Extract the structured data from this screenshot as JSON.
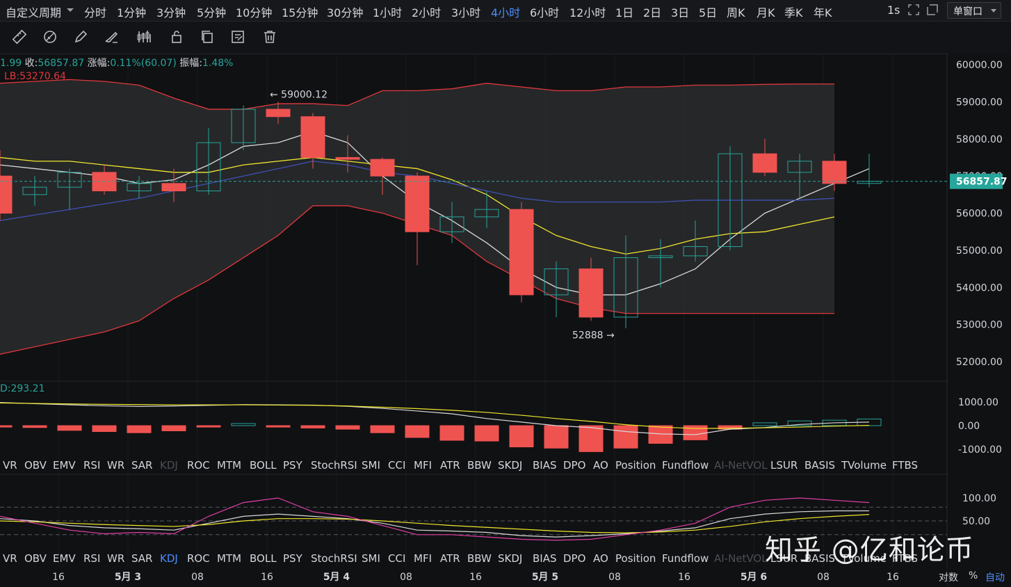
{
  "topbar": {
    "custom_period": "自定义周期",
    "intervals": [
      "分时",
      "1分钟",
      "3分钟",
      "5分钟",
      "10分钟",
      "15分钟",
      "30分钟",
      "1小时",
      "2小时",
      "3小时",
      "4小时",
      "6小时",
      "12小时",
      "1日",
      "2日",
      "3日",
      "5日",
      "周K",
      "月K",
      "季K",
      "年K"
    ],
    "active_interval": "4小时",
    "refresh": "1s",
    "window_mode": "单窗口"
  },
  "toolbar": {
    "tools": [
      "ruler-icon",
      "measure-icon",
      "pen-icon",
      "brush-icon",
      "indicator-icon",
      "lock-icon",
      "copy-icon",
      "edit-icon",
      "delete-icon"
    ]
  },
  "info": {
    "partial_prefix": "1.99",
    "close_label": "收:",
    "close_value": "56857.87",
    "change_label": "涨幅:",
    "change_value": "0.11%(60.07)",
    "amp_label": "振幅:",
    "amp_value": "1.48%",
    "lb_label": "LB:53270.64"
  },
  "macd_info": "D:293.21",
  "indicators_row1": [
    "VR",
    "OBV",
    "EMV",
    "RSI",
    "WR",
    "SAR",
    "KDJ",
    "ROC",
    "MTM",
    "BOLL",
    "PSY",
    "StochRSI",
    "SMI",
    "CCI",
    "MFI",
    "ATR",
    "BBW",
    "SKDJ",
    "BIAS",
    "DPO",
    "AO",
    "Position",
    "Fundflow",
    "AI-NetVOL",
    "LSUR",
    "BASIS",
    "TVolume",
    "FTBS"
  ],
  "indicators_row1_dim": [
    "KDJ",
    "AI-NetVOL"
  ],
  "indicators_row2": [
    "VR",
    "OBV",
    "EMV",
    "RSI",
    "WR",
    "SAR",
    "KDJ",
    "ROC",
    "MTM",
    "BOLL",
    "PSY",
    "StochRSI",
    "SMI",
    "CCI",
    "MFI",
    "ATR",
    "BBW",
    "SKDJ",
    "BIAS",
    "DPO",
    "AO",
    "Position",
    "Fundflow",
    "AI-NetVOL",
    "LSUR",
    "BASIS",
    "TVolume",
    "FTBS"
  ],
  "indicators_row2_active": "KDJ",
  "indicators_row2_dim": [
    "AI-NetVOL"
  ],
  "watermark": "知乎 @亿和论币",
  "bottom_right": {
    "scale_log": "对数",
    "scale_pct": "%",
    "scale_auto": "自动"
  },
  "colors": {
    "up": "#26a69a",
    "down": "#ef5350",
    "accent": "#4c8dff",
    "boll_band": "#e0383c",
    "ma_white": "#d9d9d9",
    "ma_yellow": "#f0e62c",
    "ma_blue": "#3f51b5",
    "kdj_pink": "#e040a6"
  },
  "chart_data": {
    "type": "candlestick",
    "x_axis_labels": [
      "16",
      "5月 3",
      "08",
      "16",
      "5月 4",
      "08",
      "16",
      "5月 5",
      "08",
      "16",
      "5月 6",
      "08",
      "16"
    ],
    "y_axis": {
      "ticks": [
        60000,
        59000,
        58000,
        57000,
        56000,
        55000,
        54000,
        53000,
        52000
      ],
      "range": [
        51500,
        60300
      ]
    },
    "last_price": "56857.87",
    "annotations": {
      "high": "59000.12",
      "low": "52888"
    },
    "candles": [
      {
        "o": 57000,
        "h": 57700,
        "c": 56000,
        "l": 55800
      },
      {
        "o": 56500,
        "h": 57000,
        "c": 56700,
        "l": 56200
      },
      {
        "o": 56700,
        "h": 57200,
        "c": 57100,
        "l": 56100
      },
      {
        "o": 57100,
        "h": 57300,
        "c": 56600,
        "l": 56500
      },
      {
        "o": 56600,
        "h": 57000,
        "c": 56800,
        "l": 56400
      },
      {
        "o": 56800,
        "h": 57200,
        "c": 56600,
        "l": 56300
      },
      {
        "o": 56600,
        "h": 58300,
        "c": 57900,
        "l": 56500
      },
      {
        "o": 57900,
        "h": 58900,
        "c": 58800,
        "l": 57700
      },
      {
        "o": 58800,
        "h": 59000,
        "c": 58600,
        "l": 58400
      },
      {
        "o": 58600,
        "h": 58700,
        "c": 57500,
        "l": 57200
      },
      {
        "o": 57500,
        "h": 58100,
        "c": 57450,
        "l": 57100
      },
      {
        "o": 57450,
        "h": 57500,
        "c": 57000,
        "l": 56500
      },
      {
        "o": 57000,
        "h": 57100,
        "c": 55500,
        "l": 54600
      },
      {
        "o": 55500,
        "h": 56300,
        "c": 55900,
        "l": 55200
      },
      {
        "o": 55900,
        "h": 56600,
        "c": 56100,
        "l": 55600
      },
      {
        "o": 56100,
        "h": 56300,
        "c": 53800,
        "l": 53600
      },
      {
        "o": 53800,
        "h": 54700,
        "c": 54500,
        "l": 53200
      },
      {
        "o": 54500,
        "h": 54800,
        "c": 53200,
        "l": 53100
      },
      {
        "o": 53200,
        "h": 55400,
        "c": 54800,
        "l": 52900
      },
      {
        "o": 54800,
        "h": 55300,
        "c": 54850,
        "l": 54000
      },
      {
        "o": 54850,
        "h": 55800,
        "c": 55100,
        "l": 54700
      },
      {
        "o": 55100,
        "h": 57800,
        "c": 57600,
        "l": 55000
      },
      {
        "o": 57600,
        "h": 58000,
        "c": 57100,
        "l": 57000
      },
      {
        "o": 57100,
        "h": 57600,
        "c": 57400,
        "l": 56400
      },
      {
        "o": 57400,
        "h": 57600,
        "c": 56800,
        "l": 56600
      },
      {
        "o": 56800,
        "h": 57600,
        "c": 56858,
        "l": 56700
      }
    ],
    "series": [
      {
        "name": "",
        "color": "#e0383c",
        "values": [
          52200,
          52400,
          52600,
          52800,
          53100,
          53700,
          54200,
          54800,
          55400,
          56200,
          56200,
          56000,
          55700,
          55400,
          54700,
          54200,
          53700,
          53450,
          53300,
          53300,
          53300,
          53300,
          53300,
          53300,
          53300
        ]
      },
      {
        "name": "",
        "color": "#e0383c",
        "values": [
          59500,
          59550,
          59600,
          59550,
          59450,
          59100,
          58800,
          58800,
          58950,
          58950,
          58900,
          59300,
          59300,
          59350,
          59500,
          59400,
          59300,
          59300,
          59400,
          59400,
          59450,
          59450,
          59470,
          59480,
          59480
        ]
      },
      {
        "name": "",
        "color": "#d9d9d9",
        "values": [
          57300,
          57200,
          57100,
          57000,
          56800,
          56900,
          57300,
          57800,
          57900,
          58200,
          57900,
          57000,
          56300,
          55800,
          55200,
          54500,
          54000,
          53800,
          53800,
          54100,
          54500,
          55300,
          56000,
          56400,
          56800,
          57200
        ]
      },
      {
        "name": "",
        "color": "#f0e62c",
        "values": [
          57500,
          57400,
          57400,
          57300,
          57200,
          57100,
          57100,
          57300,
          57400,
          57500,
          57400,
          57300,
          57200,
          56900,
          56500,
          55900,
          55400,
          55100,
          54900,
          55050,
          55300,
          55450,
          55500,
          55700,
          55900
        ]
      },
      {
        "name": "",
        "color": "#3f51b5",
        "values": [
          55800,
          55950,
          56100,
          56250,
          56400,
          56600,
          56800,
          57000,
          57200,
          57400,
          57300,
          57100,
          57000,
          56800,
          56600,
          56400,
          56300,
          56300,
          56300,
          56300,
          56350,
          56350,
          56350,
          56350,
          56400
        ]
      }
    ],
    "macd": {
      "range": [
        -1200,
        1200
      ],
      "ticks": [
        1000,
        0,
        -1000
      ],
      "histogram": [
        -60,
        -80,
        -200,
        -250,
        -300,
        -220,
        -60,
        90,
        -60,
        -100,
        -150,
        -300,
        -500,
        -620,
        -650,
        -900,
        -950,
        -1100,
        -950,
        -750,
        -600,
        -150,
        120,
        200,
        230,
        280
      ],
      "dif": [
        980,
        930,
        880,
        840,
        810,
        830,
        860,
        890,
        880,
        870,
        820,
        730,
        620,
        500,
        300,
        150,
        0,
        -80,
        -250,
        -350,
        -380,
        -150,
        -80,
        50,
        120,
        150
      ],
      "dea": [
        960,
        940,
        920,
        900,
        890,
        880,
        880,
        880,
        870,
        860,
        830,
        780,
        720,
        650,
        560,
        440,
        300,
        180,
        40,
        -60,
        -120,
        -110,
        -90,
        -60,
        -20,
        10
      ]
    },
    "kdj": {
      "range": [
        0,
        120
      ],
      "ticks": [
        100,
        50
      ],
      "k": [
        55,
        50,
        40,
        35,
        33,
        30,
        45,
        60,
        65,
        60,
        55,
        45,
        30,
        28,
        25,
        18,
        15,
        18,
        22,
        28,
        35,
        55,
        65,
        70,
        72,
        72
      ],
      "d": [
        50,
        48,
        45,
        42,
        40,
        38,
        42,
        50,
        55,
        55,
        54,
        50,
        45,
        40,
        36,
        32,
        28,
        25,
        24,
        26,
        30,
        38,
        48,
        55,
        60,
        64
      ],
      "j": [
        60,
        45,
        30,
        22,
        25,
        22,
        60,
        90,
        100,
        70,
        60,
        40,
        20,
        20,
        15,
        10,
        8,
        10,
        20,
        30,
        45,
        80,
        95,
        100,
        95,
        90
      ]
    }
  }
}
